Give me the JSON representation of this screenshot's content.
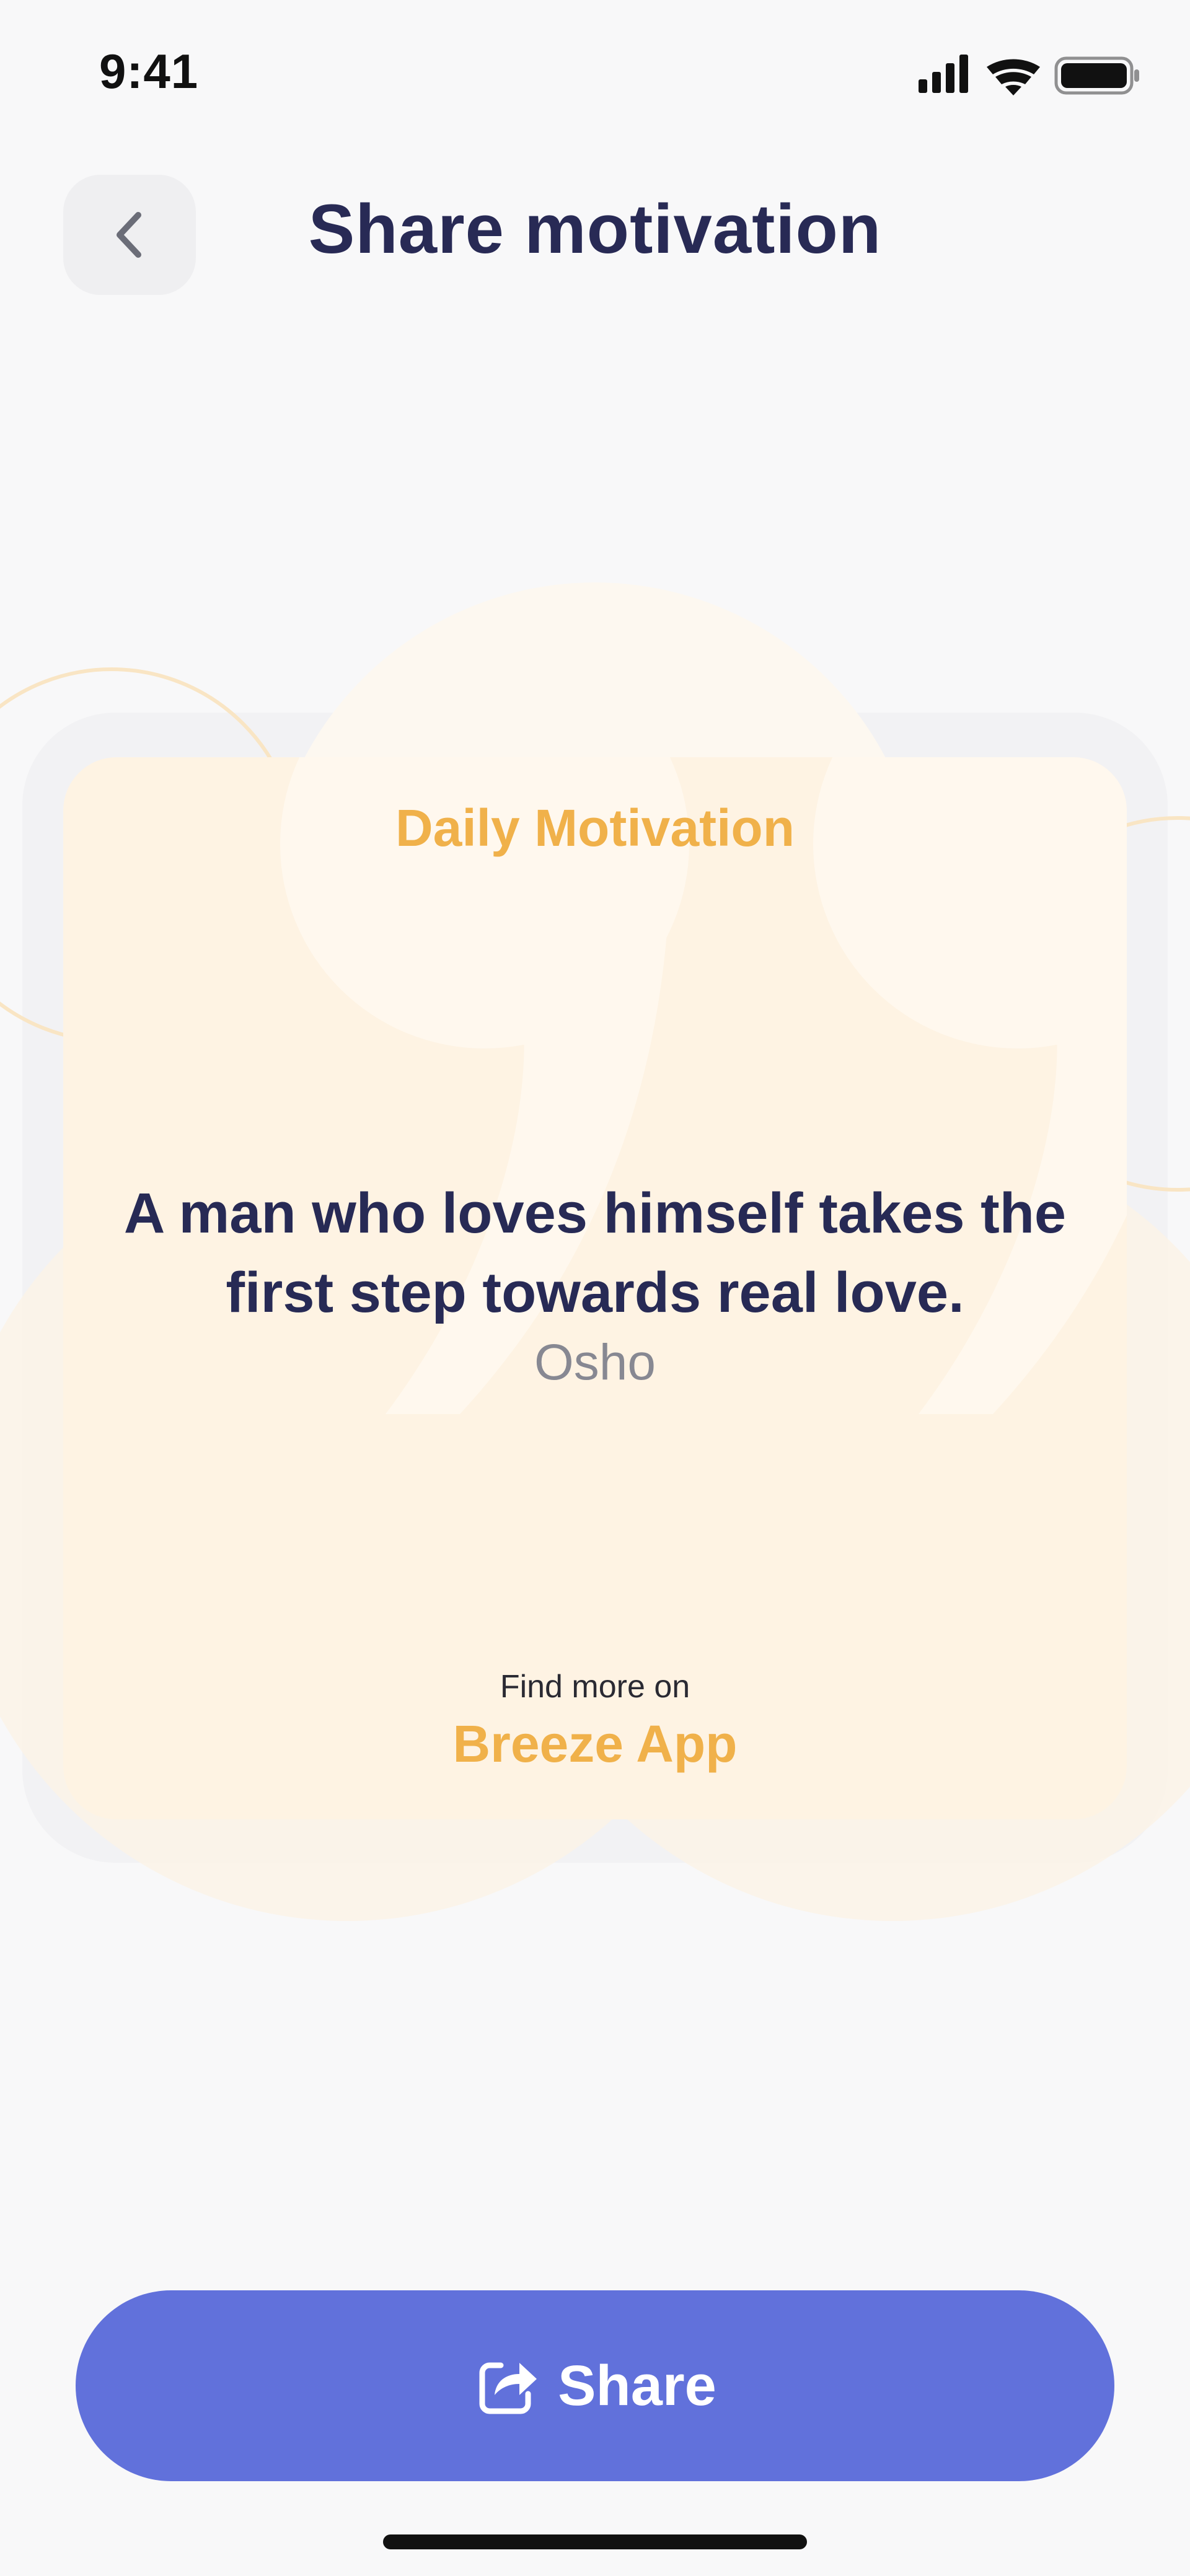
{
  "status_bar": {
    "time": "9:41"
  },
  "header": {
    "title": "Share motivation",
    "back_icon": "chevron-left-icon"
  },
  "card": {
    "label": "Daily Motivation",
    "quote": "A man who loves himself takes the first step towards real love.",
    "author": "Osho",
    "find_more": "Find more on",
    "brand": "Breeze App"
  },
  "share": {
    "label": "Share",
    "icon": "share-icon"
  },
  "colors": {
    "background": "#f8f8f9",
    "card": "#fef3e3",
    "accent": "#f0b14a",
    "title": "#282a55",
    "button": "#6171db"
  }
}
